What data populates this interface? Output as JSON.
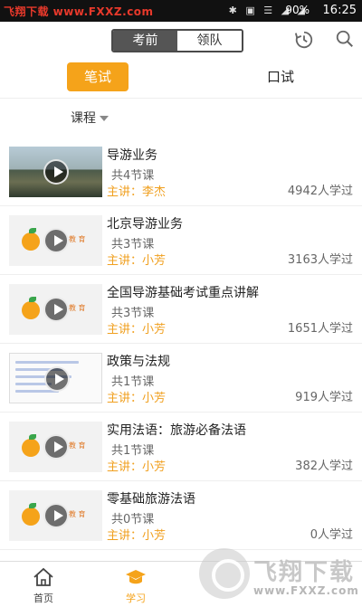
{
  "status_bar": {
    "watermark": "飞翔下载 www.FXXZ.com",
    "battery": "90%",
    "time": "16:25"
  },
  "top_toggle": {
    "options": [
      "考前",
      "领队"
    ],
    "selected": "考前"
  },
  "mode_tabs": {
    "written": "笔试",
    "oral": "口试",
    "selected": "笔试"
  },
  "filter": {
    "label": "课程"
  },
  "courses": [
    {
      "title": "导游业务",
      "lessons": "共4节课",
      "teacher": "主讲：李杰",
      "learners": "4942人学过",
      "thumb": "photo"
    },
    {
      "title": "北京导游业务",
      "lessons": "共3节课",
      "teacher": "主讲：小芳",
      "learners": "3163人学过",
      "thumb": "brand"
    },
    {
      "title": "全国导游基础考试重点讲解",
      "lessons": "共3节课",
      "teacher": "主讲：小芳",
      "learners": "1651人学过",
      "thumb": "brand"
    },
    {
      "title": "政策与法规",
      "lessons": "共1节课",
      "teacher": "主讲：小芳",
      "learners": "919人学过",
      "thumb": "slide"
    },
    {
      "title": "实用法语：旅游必备法语",
      "lessons": "共1节课",
      "teacher": "主讲：小芳",
      "learners": "382人学过",
      "thumb": "brand"
    },
    {
      "title": "零基础旅游法语",
      "lessons": "共0节课",
      "teacher": "主讲：小芳",
      "learners": "0人学过",
      "thumb": "brand"
    }
  ],
  "brand_thumb_text": "教 育",
  "bottom_nav": {
    "home": "首页",
    "study": "学习",
    "active": "学习"
  },
  "bottom_watermark": {
    "text": "飞翔下载",
    "url": "www.FXXZ.com"
  },
  "colors": {
    "accent": "#f5a31a",
    "teacher_text": "#f0a020",
    "toggle_selected_bg": "#555555"
  }
}
